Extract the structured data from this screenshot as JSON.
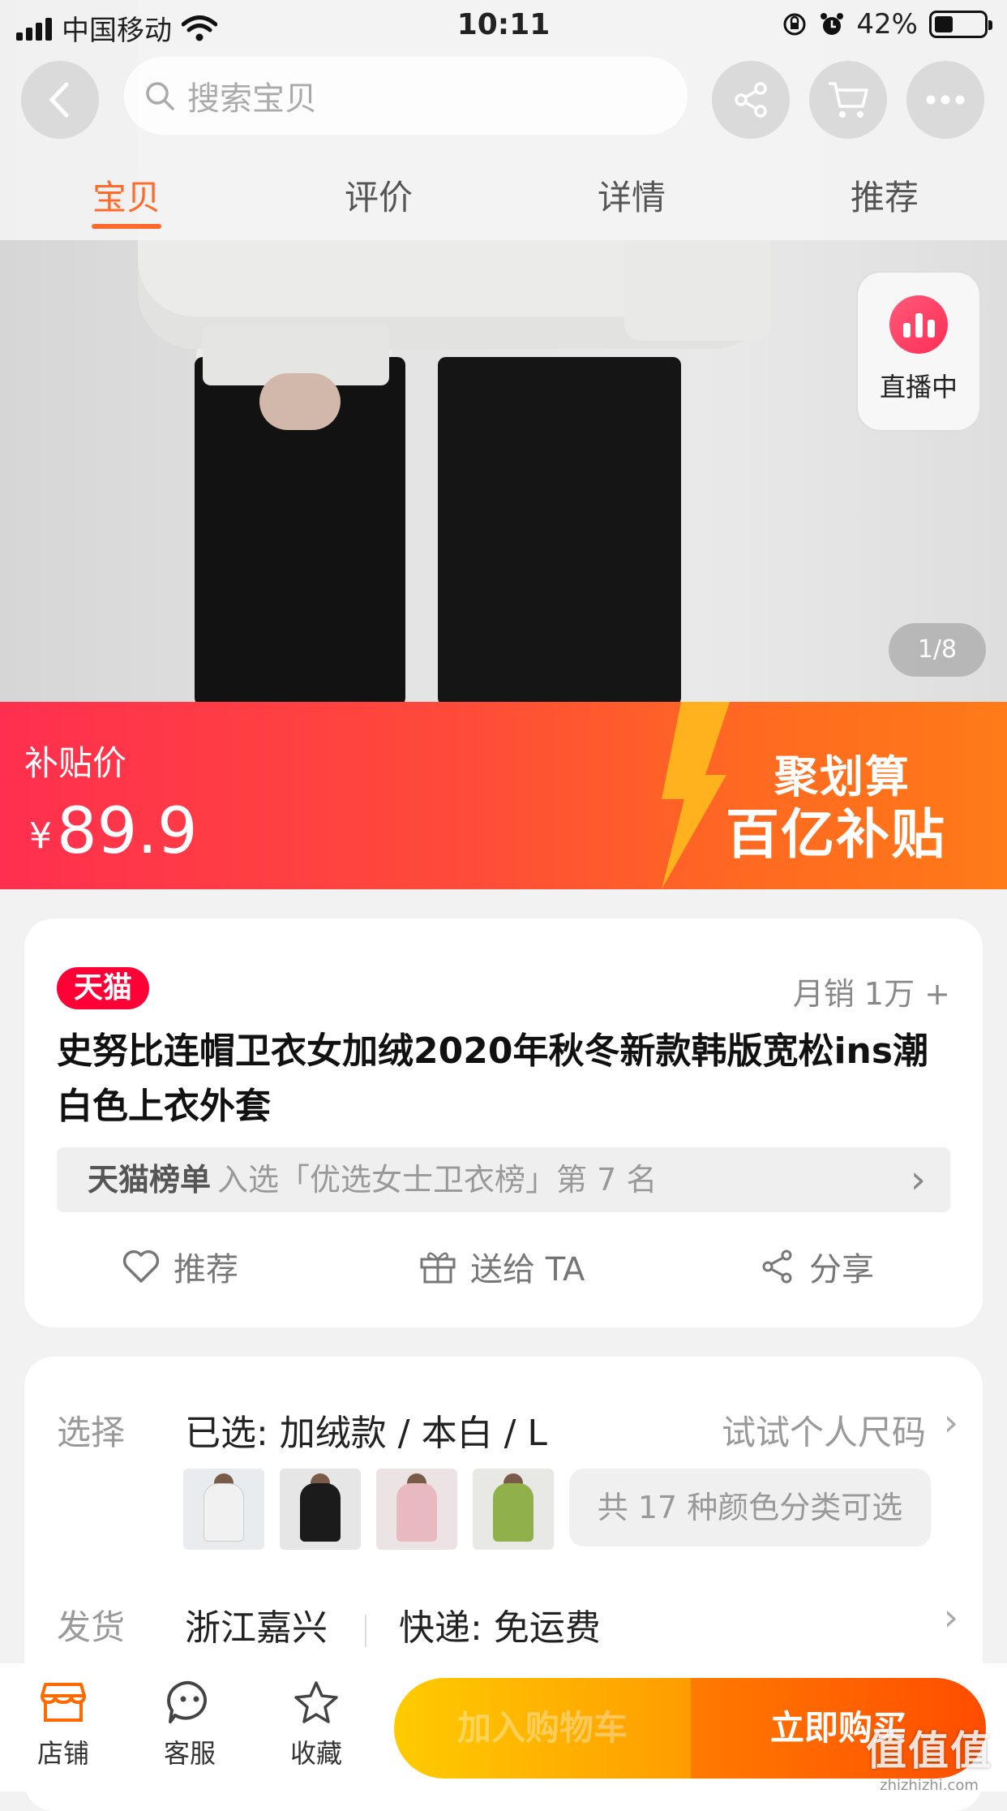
{
  "status_bar": {
    "carrier": "中国移动",
    "time": "10:11",
    "battery": "42%"
  },
  "nav": {
    "search_placeholder": "搜索宝贝",
    "tabs": [
      {
        "label": "宝贝",
        "active": true
      },
      {
        "label": "评价",
        "active": false
      },
      {
        "label": "详情",
        "active": false
      },
      {
        "label": "推荐",
        "active": false
      }
    ]
  },
  "gallery": {
    "live_label": "直播中",
    "counter": "1/8"
  },
  "price_banner": {
    "price_label": "补贴价",
    "currency": "¥",
    "price": "89.9",
    "promo_line1": "聚划算",
    "promo_line2": "百亿补贴"
  },
  "product": {
    "badge": "天猫",
    "monthly_sales": "月销 1万 +",
    "title": "史努比连帽卫衣女加绒2020年秋冬新款韩版宽松ins潮白色上衣外套",
    "ranking": {
      "name": "天猫榜单",
      "text": "入选「优选女士卫衣榜」第 7 名"
    },
    "actions": [
      {
        "label": "推荐",
        "icon": "heart-icon"
      },
      {
        "label": "送给 TA",
        "icon": "gift-icon"
      },
      {
        "label": "分享",
        "icon": "share-icon"
      }
    ]
  },
  "options": {
    "select_label": "选择",
    "selected": "已选:  加绒款 / 本白 / L",
    "size_hint": "试试个人尺码",
    "color_count": "共 17 种颜色分类可选",
    "thumbs": [
      {
        "color": "#f1f1f1",
        "bg": "#e9ecef"
      },
      {
        "color": "#1b1b1b",
        "bg": "#e6e6e6"
      },
      {
        "color": "#e8b9bf",
        "bg": "#ece4e4"
      },
      {
        "color": "#8fb04a",
        "bg": "#e8e8e4"
      }
    ],
    "ship_label": "发货",
    "ship_from": "浙江嘉兴",
    "ship_method": "快递: 免运费"
  },
  "bottom_bar": {
    "store": "店铺",
    "service": "客服",
    "favorite": "收藏",
    "add_to_cart": "加入购物车",
    "buy_now": "立即购买"
  },
  "watermark": {
    "line1": "值值值",
    "line2": "zhizhizhi.com"
  },
  "colors": {
    "accent": "#ff6a2a",
    "tmall_red": "#ff0036",
    "banner_start": "#ff2f4f",
    "banner_end": "#ff7a18"
  }
}
